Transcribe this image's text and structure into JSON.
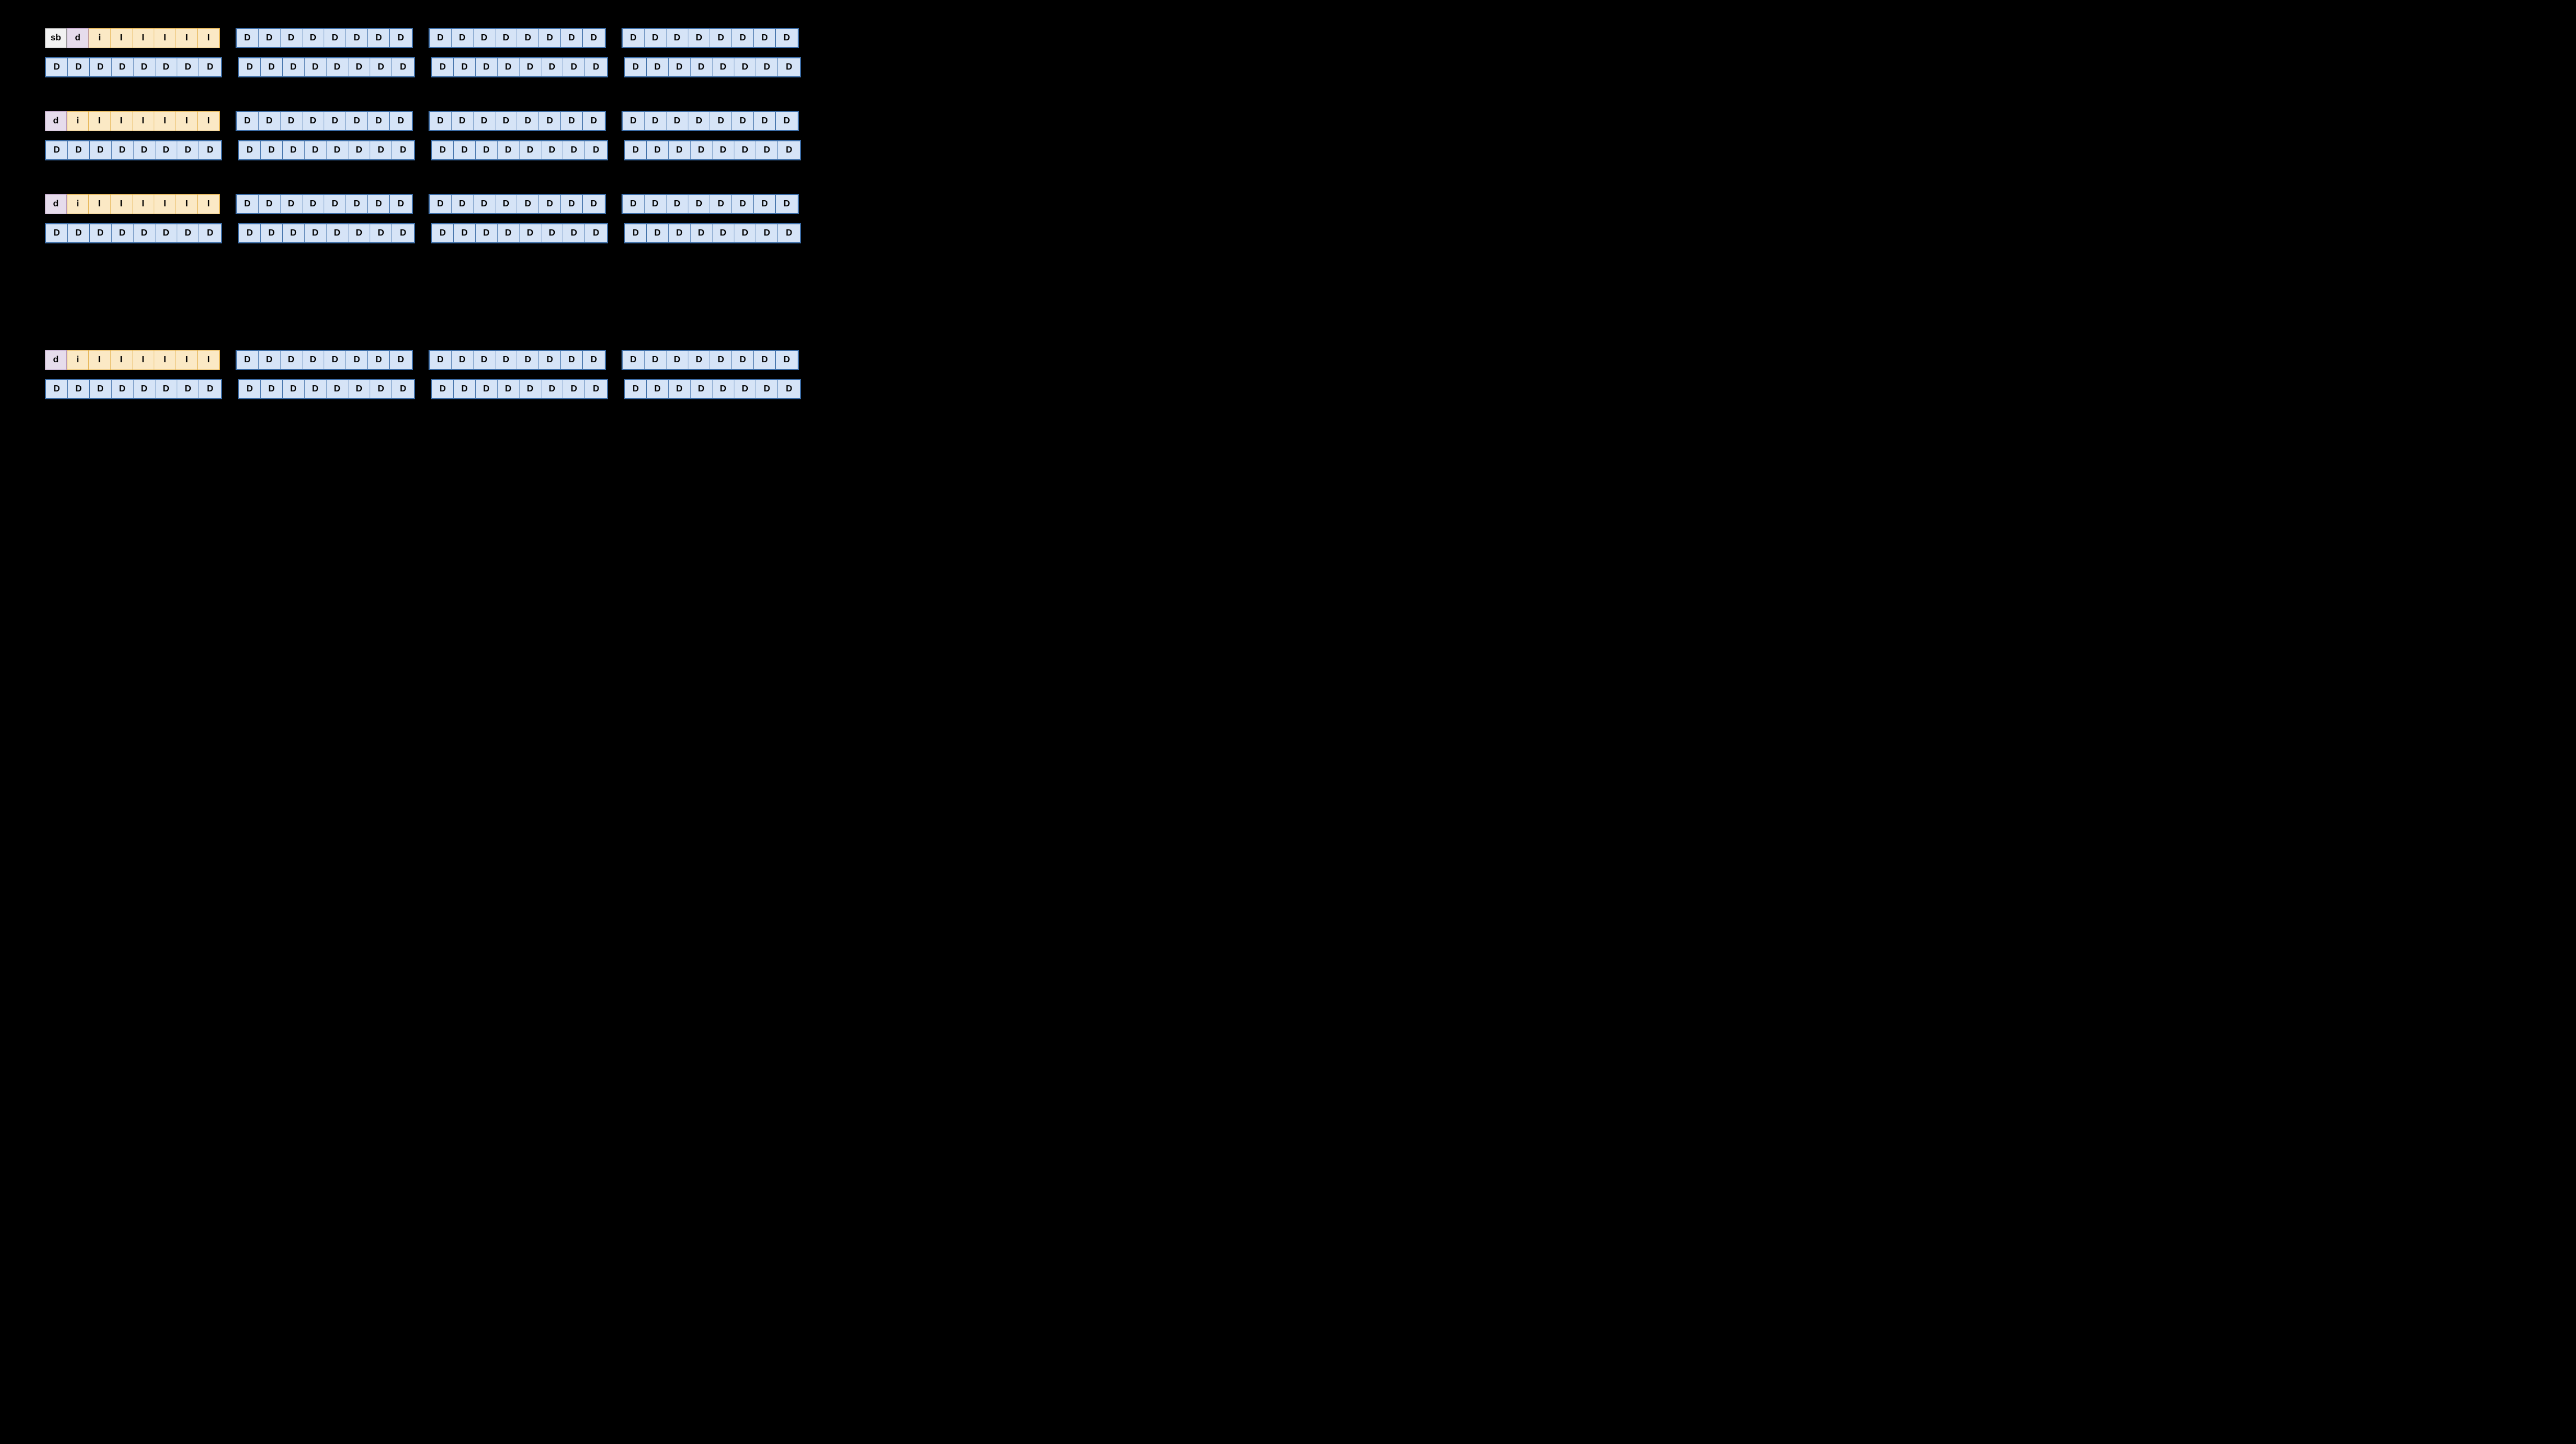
{
  "labels": {
    "sb": "sb",
    "d_small": "d",
    "i_small": "i",
    "I": "I",
    "D": "D"
  },
  "panels": [
    {
      "id": "panel-0",
      "extra_gap": false,
      "rows": [
        {
          "groups": [
            {
              "cells": [
                {
                  "t": "sb"
                },
                {
                  "t": "d_small"
                },
                {
                  "t": "i_small",
                  "first_i": true
                },
                {
                  "t": "I"
                },
                {
                  "t": "I"
                },
                {
                  "t": "I"
                },
                {
                  "t": "I"
                },
                {
                  "t": "I",
                  "last_i": true
                }
              ]
            },
            {
              "cells": [
                {
                  "t": "D"
                },
                {
                  "t": "D"
                },
                {
                  "t": "D"
                },
                {
                  "t": "D"
                },
                {
                  "t": "D"
                },
                {
                  "t": "D"
                },
                {
                  "t": "D"
                },
                {
                  "t": "D"
                }
              ]
            },
            {
              "cells": [
                {
                  "t": "D"
                },
                {
                  "t": "D"
                },
                {
                  "t": "D"
                },
                {
                  "t": "D"
                },
                {
                  "t": "D"
                },
                {
                  "t": "D"
                },
                {
                  "t": "D"
                },
                {
                  "t": "D"
                }
              ]
            },
            {
              "cells": [
                {
                  "t": "D"
                },
                {
                  "t": "D"
                },
                {
                  "t": "D"
                },
                {
                  "t": "D"
                },
                {
                  "t": "D"
                },
                {
                  "t": "D"
                },
                {
                  "t": "D"
                },
                {
                  "t": "D"
                }
              ]
            }
          ]
        },
        {
          "groups": [
            {
              "cells": [
                {
                  "t": "D"
                },
                {
                  "t": "D"
                },
                {
                  "t": "D"
                },
                {
                  "t": "D"
                },
                {
                  "t": "D"
                },
                {
                  "t": "D"
                },
                {
                  "t": "D"
                },
                {
                  "t": "D"
                }
              ]
            },
            {
              "cells": [
                {
                  "t": "D"
                },
                {
                  "t": "D"
                },
                {
                  "t": "D"
                },
                {
                  "t": "D"
                },
                {
                  "t": "D"
                },
                {
                  "t": "D"
                },
                {
                  "t": "D"
                },
                {
                  "t": "D"
                }
              ]
            },
            {
              "cells": [
                {
                  "t": "D"
                },
                {
                  "t": "D"
                },
                {
                  "t": "D"
                },
                {
                  "t": "D"
                },
                {
                  "t": "D"
                },
                {
                  "t": "D"
                },
                {
                  "t": "D"
                },
                {
                  "t": "D"
                }
              ]
            },
            {
              "cells": [
                {
                  "t": "D"
                },
                {
                  "t": "D"
                },
                {
                  "t": "D"
                },
                {
                  "t": "D"
                },
                {
                  "t": "D"
                },
                {
                  "t": "D"
                },
                {
                  "t": "D"
                },
                {
                  "t": "D"
                }
              ]
            }
          ]
        }
      ]
    },
    {
      "id": "panel-1",
      "extra_gap": false,
      "rows": [
        {
          "groups": [
            {
              "cells": [
                {
                  "t": "d_small",
                  "first": true
                },
                {
                  "t": "i_small",
                  "first_i": true
                },
                {
                  "t": "I"
                },
                {
                  "t": "I"
                },
                {
                  "t": "I"
                },
                {
                  "t": "I"
                },
                {
                  "t": "I"
                },
                {
                  "t": "I",
                  "last_i": true
                }
              ]
            },
            {
              "cells": [
                {
                  "t": "D"
                },
                {
                  "t": "D"
                },
                {
                  "t": "D"
                },
                {
                  "t": "D"
                },
                {
                  "t": "D"
                },
                {
                  "t": "D"
                },
                {
                  "t": "D"
                },
                {
                  "t": "D"
                }
              ]
            },
            {
              "cells": [
                {
                  "t": "D"
                },
                {
                  "t": "D"
                },
                {
                  "t": "D"
                },
                {
                  "t": "D"
                },
                {
                  "t": "D"
                },
                {
                  "t": "D"
                },
                {
                  "t": "D"
                },
                {
                  "t": "D"
                }
              ]
            },
            {
              "cells": [
                {
                  "t": "D"
                },
                {
                  "t": "D"
                },
                {
                  "t": "D"
                },
                {
                  "t": "D"
                },
                {
                  "t": "D"
                },
                {
                  "t": "D"
                },
                {
                  "t": "D"
                },
                {
                  "t": "D"
                }
              ]
            }
          ]
        },
        {
          "groups": [
            {
              "cells": [
                {
                  "t": "D"
                },
                {
                  "t": "D"
                },
                {
                  "t": "D"
                },
                {
                  "t": "D"
                },
                {
                  "t": "D"
                },
                {
                  "t": "D"
                },
                {
                  "t": "D"
                },
                {
                  "t": "D"
                }
              ]
            },
            {
              "cells": [
                {
                  "t": "D"
                },
                {
                  "t": "D"
                },
                {
                  "t": "D"
                },
                {
                  "t": "D"
                },
                {
                  "t": "D"
                },
                {
                  "t": "D"
                },
                {
                  "t": "D"
                },
                {
                  "t": "D"
                }
              ]
            },
            {
              "cells": [
                {
                  "t": "D"
                },
                {
                  "t": "D"
                },
                {
                  "t": "D"
                },
                {
                  "t": "D"
                },
                {
                  "t": "D"
                },
                {
                  "t": "D"
                },
                {
                  "t": "D"
                },
                {
                  "t": "D"
                }
              ]
            },
            {
              "cells": [
                {
                  "t": "D"
                },
                {
                  "t": "D"
                },
                {
                  "t": "D"
                },
                {
                  "t": "D"
                },
                {
                  "t": "D"
                },
                {
                  "t": "D"
                },
                {
                  "t": "D"
                },
                {
                  "t": "D"
                }
              ]
            }
          ]
        }
      ]
    },
    {
      "id": "panel-2",
      "extra_gap": true,
      "rows": [
        {
          "groups": [
            {
              "cells": [
                {
                  "t": "d_small",
                  "first": true
                },
                {
                  "t": "i_small",
                  "first_i": true
                },
                {
                  "t": "I"
                },
                {
                  "t": "I"
                },
                {
                  "t": "I"
                },
                {
                  "t": "I"
                },
                {
                  "t": "I"
                },
                {
                  "t": "I",
                  "last_i": true
                }
              ]
            },
            {
              "cells": [
                {
                  "t": "D"
                },
                {
                  "t": "D"
                },
                {
                  "t": "D"
                },
                {
                  "t": "D"
                },
                {
                  "t": "D"
                },
                {
                  "t": "D"
                },
                {
                  "t": "D"
                },
                {
                  "t": "D"
                }
              ]
            },
            {
              "cells": [
                {
                  "t": "D"
                },
                {
                  "t": "D"
                },
                {
                  "t": "D"
                },
                {
                  "t": "D"
                },
                {
                  "t": "D"
                },
                {
                  "t": "D"
                },
                {
                  "t": "D"
                },
                {
                  "t": "D"
                }
              ]
            },
            {
              "cells": [
                {
                  "t": "D"
                },
                {
                  "t": "D"
                },
                {
                  "t": "D"
                },
                {
                  "t": "D"
                },
                {
                  "t": "D"
                },
                {
                  "t": "D"
                },
                {
                  "t": "D"
                },
                {
                  "t": "D"
                }
              ]
            }
          ]
        },
        {
          "groups": [
            {
              "cells": [
                {
                  "t": "D"
                },
                {
                  "t": "D"
                },
                {
                  "t": "D"
                },
                {
                  "t": "D"
                },
                {
                  "t": "D"
                },
                {
                  "t": "D"
                },
                {
                  "t": "D"
                },
                {
                  "t": "D"
                }
              ]
            },
            {
              "cells": [
                {
                  "t": "D"
                },
                {
                  "t": "D"
                },
                {
                  "t": "D"
                },
                {
                  "t": "D"
                },
                {
                  "t": "D"
                },
                {
                  "t": "D"
                },
                {
                  "t": "D"
                },
                {
                  "t": "D"
                }
              ]
            },
            {
              "cells": [
                {
                  "t": "D"
                },
                {
                  "t": "D"
                },
                {
                  "t": "D"
                },
                {
                  "t": "D"
                },
                {
                  "t": "D"
                },
                {
                  "t": "D"
                },
                {
                  "t": "D"
                },
                {
                  "t": "D"
                }
              ]
            },
            {
              "cells": [
                {
                  "t": "D"
                },
                {
                  "t": "D"
                },
                {
                  "t": "D"
                },
                {
                  "t": "D"
                },
                {
                  "t": "D"
                },
                {
                  "t": "D"
                },
                {
                  "t": "D"
                },
                {
                  "t": "D"
                }
              ]
            }
          ]
        }
      ]
    },
    {
      "id": "panel-3",
      "extra_gap": false,
      "rows": [
        {
          "groups": [
            {
              "cells": [
                {
                  "t": "d_small",
                  "first": true
                },
                {
                  "t": "i_small",
                  "first_i": true
                },
                {
                  "t": "I"
                },
                {
                  "t": "I"
                },
                {
                  "t": "I"
                },
                {
                  "t": "I"
                },
                {
                  "t": "I"
                },
                {
                  "t": "I",
                  "last_i": true
                }
              ]
            },
            {
              "cells": [
                {
                  "t": "D"
                },
                {
                  "t": "D"
                },
                {
                  "t": "D"
                },
                {
                  "t": "D"
                },
                {
                  "t": "D"
                },
                {
                  "t": "D"
                },
                {
                  "t": "D"
                },
                {
                  "t": "D"
                }
              ]
            },
            {
              "cells": [
                {
                  "t": "D"
                },
                {
                  "t": "D"
                },
                {
                  "t": "D"
                },
                {
                  "t": "D"
                },
                {
                  "t": "D"
                },
                {
                  "t": "D"
                },
                {
                  "t": "D"
                },
                {
                  "t": "D"
                }
              ]
            },
            {
              "cells": [
                {
                  "t": "D"
                },
                {
                  "t": "D"
                },
                {
                  "t": "D"
                },
                {
                  "t": "D"
                },
                {
                  "t": "D"
                },
                {
                  "t": "D"
                },
                {
                  "t": "D"
                },
                {
                  "t": "D"
                }
              ]
            }
          ]
        },
        {
          "groups": [
            {
              "cells": [
                {
                  "t": "D"
                },
                {
                  "t": "D"
                },
                {
                  "t": "D"
                },
                {
                  "t": "D"
                },
                {
                  "t": "D"
                },
                {
                  "t": "D"
                },
                {
                  "t": "D"
                },
                {
                  "t": "D"
                }
              ]
            },
            {
              "cells": [
                {
                  "t": "D"
                },
                {
                  "t": "D"
                },
                {
                  "t": "D"
                },
                {
                  "t": "D"
                },
                {
                  "t": "D"
                },
                {
                  "t": "D"
                },
                {
                  "t": "D"
                },
                {
                  "t": "D"
                }
              ]
            },
            {
              "cells": [
                {
                  "t": "D"
                },
                {
                  "t": "D"
                },
                {
                  "t": "D"
                },
                {
                  "t": "D"
                },
                {
                  "t": "D"
                },
                {
                  "t": "D"
                },
                {
                  "t": "D"
                },
                {
                  "t": "D"
                }
              ]
            },
            {
              "cells": [
                {
                  "t": "D"
                },
                {
                  "t": "D"
                },
                {
                  "t": "D"
                },
                {
                  "t": "D"
                },
                {
                  "t": "D"
                },
                {
                  "t": "D"
                },
                {
                  "t": "D"
                },
                {
                  "t": "D"
                }
              ]
            }
          ]
        }
      ]
    }
  ]
}
